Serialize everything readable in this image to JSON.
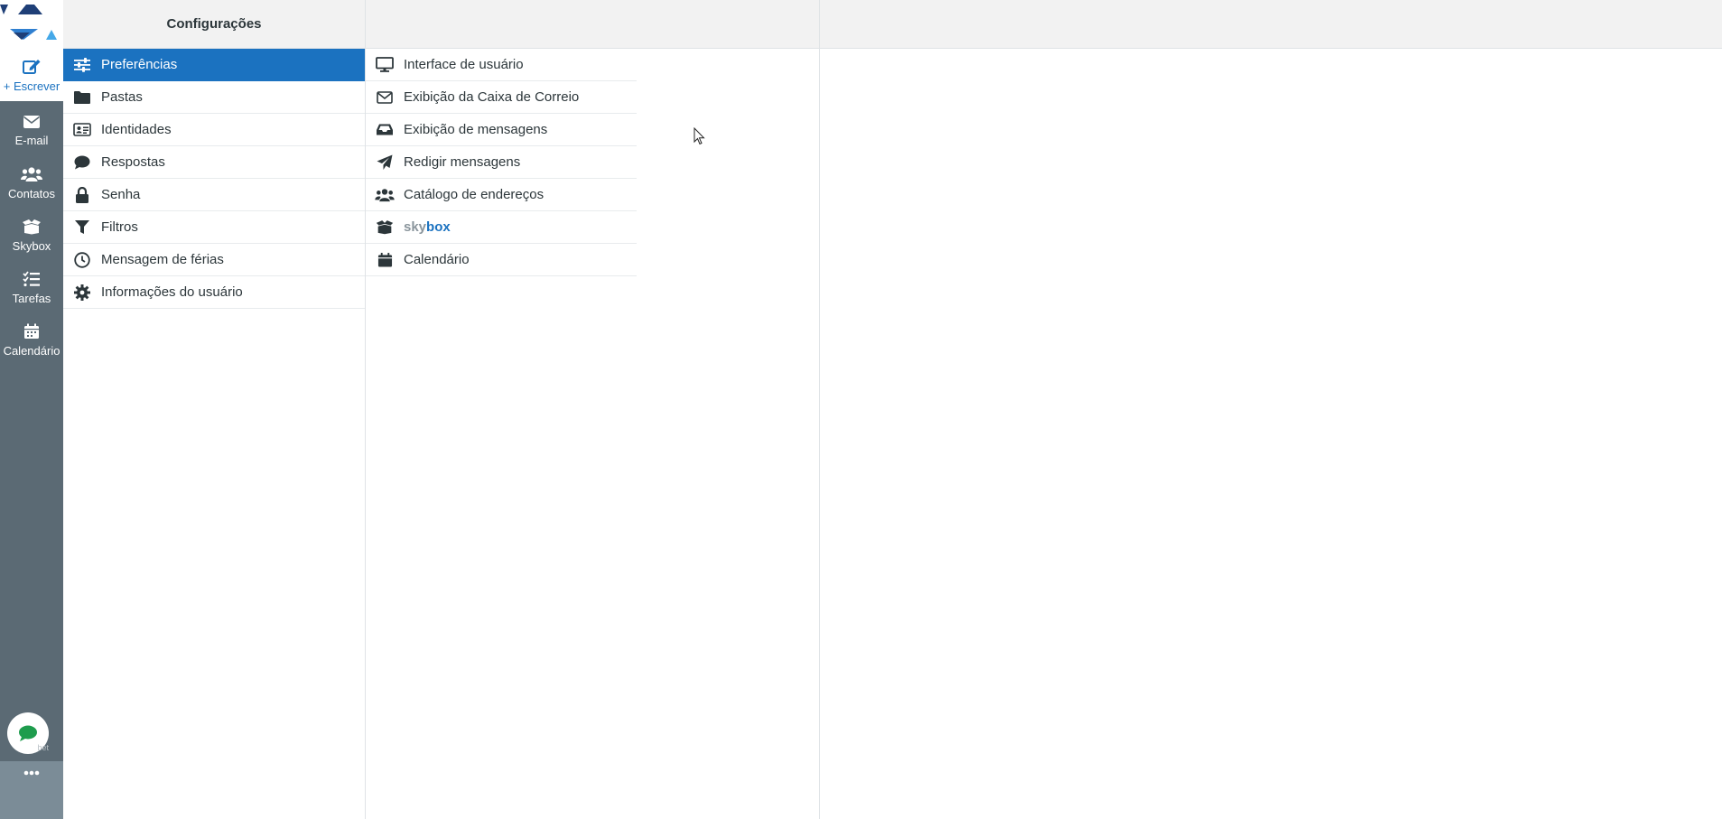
{
  "rail": {
    "compose_label": "+ Escrever",
    "items": [
      {
        "label": "E-mail",
        "icon": "envelope-icon"
      },
      {
        "label": "Contatos",
        "icon": "users-icon"
      },
      {
        "label": "Skybox",
        "icon": "box-icon"
      },
      {
        "label": "Tarefas",
        "icon": "task-list-icon"
      },
      {
        "label": "Calendário",
        "icon": "calendar-icon"
      }
    ],
    "colors": {
      "rail_bg": "#5b6a74",
      "accent": "#1b72c0"
    }
  },
  "settings": {
    "title": "Configurações",
    "items": [
      {
        "label": "Preferências",
        "icon": "sliders-icon",
        "active": true
      },
      {
        "label": "Pastas",
        "icon": "folder-icon"
      },
      {
        "label": "Identidades",
        "icon": "id-card-icon"
      },
      {
        "label": "Respostas",
        "icon": "comment-icon"
      },
      {
        "label": "Senha",
        "icon": "lock-icon"
      },
      {
        "label": "Filtros",
        "icon": "filter-icon"
      },
      {
        "label": "Mensagem de férias",
        "icon": "clock-icon"
      },
      {
        "label": "Informações do usuário",
        "icon": "gear-icon"
      }
    ]
  },
  "preferences": {
    "items": [
      {
        "label": "Interface de usuário",
        "icon": "monitor-icon"
      },
      {
        "label": "Exibição da Caixa de Correio",
        "icon": "envelope-outline-icon"
      },
      {
        "label": "Exibição de mensagens",
        "icon": "inbox-icon"
      },
      {
        "label": "Redigir mensagens",
        "icon": "paper-plane-icon"
      },
      {
        "label": "Catálogo de endereços",
        "icon": "users-icon"
      },
      {
        "label_part1": "sky",
        "label_part2": "box",
        "icon": "box-open-icon"
      },
      {
        "label": "Calendário",
        "icon": "calendar-icon"
      }
    ]
  }
}
